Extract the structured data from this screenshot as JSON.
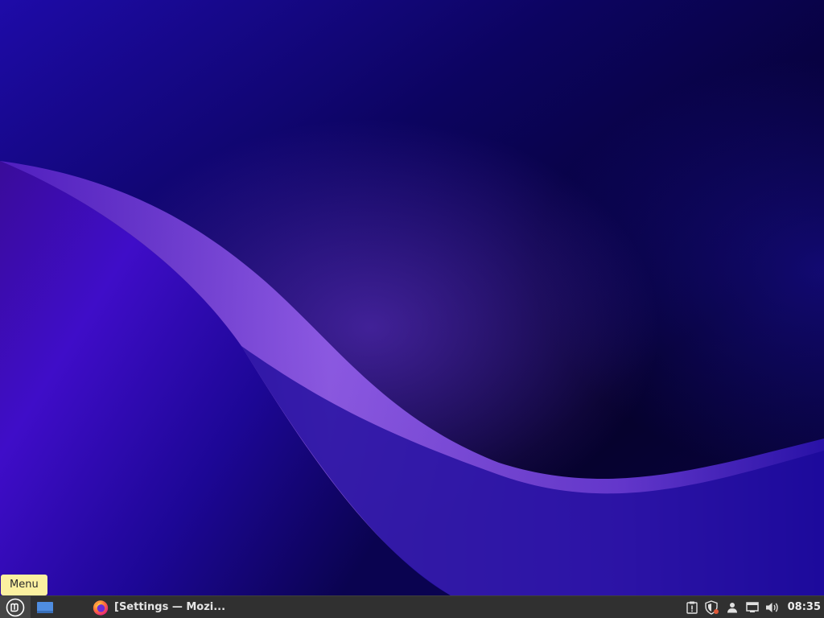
{
  "tooltip": {
    "text": "Menu"
  },
  "taskbar": {
    "window_title": "[Settings — Mozi...",
    "clock": "08:35"
  },
  "icons": {
    "menu": "linux-mint-logo-icon",
    "show_desktop": "show-desktop-icon",
    "window_app": "firefox-icon",
    "tray": [
      "clipboard-icon",
      "update-manager-shield-icon",
      "user-icon",
      "network-icon",
      "volume-icon"
    ]
  },
  "colors": {
    "taskbar": "#303030",
    "tooltip": "#fbf0a0",
    "wallpaper_dark": "#07012a",
    "wallpaper_purple": "#5a1fe0"
  }
}
